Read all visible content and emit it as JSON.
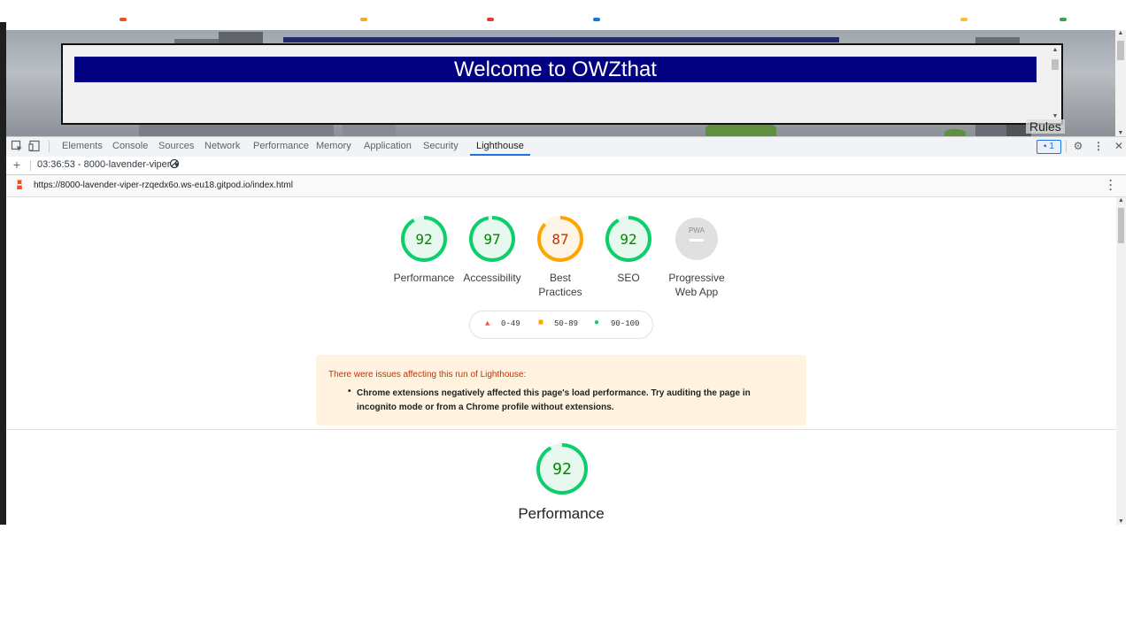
{
  "page": {
    "modal_title": "Welcome to OWZthat",
    "rules_link": "Rules"
  },
  "devtools": {
    "tabs": [
      "Elements",
      "Console",
      "Sources",
      "Network",
      "Performance",
      "Memory",
      "Application",
      "Security",
      "Lighthouse"
    ],
    "active_tab": "Lighthouse",
    "issues_count": "1",
    "run_selector": "03:36:53 - 8000-lavender-viper",
    "url": "https://8000-lavender-viper-rzqedx6o.ws-eu18.gitpod.io/index.html"
  },
  "lighthouse": {
    "scores": [
      {
        "label": "Performance",
        "value": "92",
        "color": "#0cce6b",
        "fill": "#e7f8ee",
        "score": 0.92
      },
      {
        "label": "Accessibility",
        "value": "97",
        "color": "#0cce6b",
        "fill": "#e7f8ee",
        "score": 0.97
      },
      {
        "label": "Best Practices",
        "value": "87",
        "color": "#ffa400",
        "fill": "#fff5e6",
        "score": 0.87
      },
      {
        "label": "SEO",
        "value": "92",
        "color": "#0cce6b",
        "fill": "#e7f8ee",
        "score": 0.92
      },
      {
        "label": "Progressive Web App",
        "value": "PWA",
        "color": "#bdbdbd",
        "fill": "#e0e0e0",
        "score": null
      }
    ],
    "legend": {
      "fail": "0-49",
      "average": "50-89",
      "pass": "90-100"
    },
    "colors": {
      "fail": "#ff4e42",
      "average": "#ffa400",
      "pass": "#0cce6b"
    },
    "warning": {
      "title": "There were issues affecting this run of Lighthouse:",
      "item": "Chrome extensions negatively affected this page's load performance. Try auditing the page in incognito mode or from a Chrome profile without extensions."
    },
    "section": {
      "score": "92",
      "title": "Performance"
    }
  }
}
